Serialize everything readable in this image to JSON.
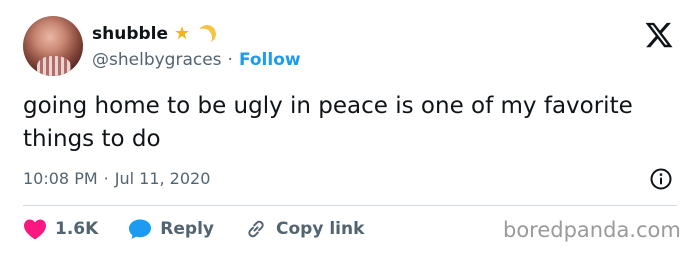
{
  "user": {
    "display_name": "shubble",
    "handle": "@shelbygraces",
    "follow_label": "Follow",
    "separator": "·"
  },
  "icons": {
    "star": "star-icon",
    "moon": "crescent-moon-icon",
    "platform_logo": "x-logo-icon",
    "info": "info-icon",
    "like": "heart-icon",
    "reply": "speech-bubble-icon",
    "copy_link": "link-icon"
  },
  "tweet": {
    "text": "going home to be ugly in peace is one of my favorite things to do",
    "time": "10:08 PM",
    "separator": "·",
    "date": "Jul 11, 2020"
  },
  "actions": {
    "likes": "1.6K",
    "reply_label": "Reply",
    "copy_link_label": "Copy link"
  },
  "watermark": "boredpanda.com",
  "colors": {
    "link_blue": "#1d9bf0",
    "heart_pink": "#f91880",
    "reply_blue": "#1d9bf0",
    "secondary_text": "#536471",
    "star_gold": "#f2b61a"
  }
}
